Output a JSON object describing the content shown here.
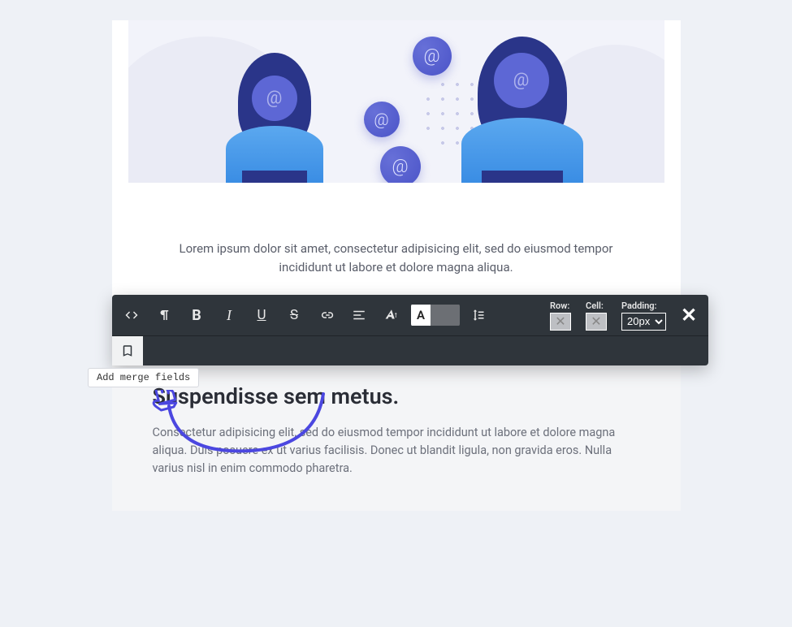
{
  "toolbar": {
    "row_label": "Row:",
    "cell_label": "Cell:",
    "padding_label": "Padding:",
    "padding_value": "20px",
    "close": "✕",
    "merge_tooltip": "Add merge fields"
  },
  "content": {
    "intro": "Lorem ipsum dolor sit amet, consectetur adipisicing elit, sed do eiusmod tempor incididunt ut labore et dolore magna aliqua.",
    "heading": "Suspendisse sem metus.",
    "body": "Consectetur adipisicing elit, sed do eiusmod tempor incididunt ut labore et dolore magna aliqua. Duis posuere ex ut varius facilisis. Donec ut blandit ligula, non gravida eros. Nulla varius nisl in enim commodo pharetra."
  }
}
